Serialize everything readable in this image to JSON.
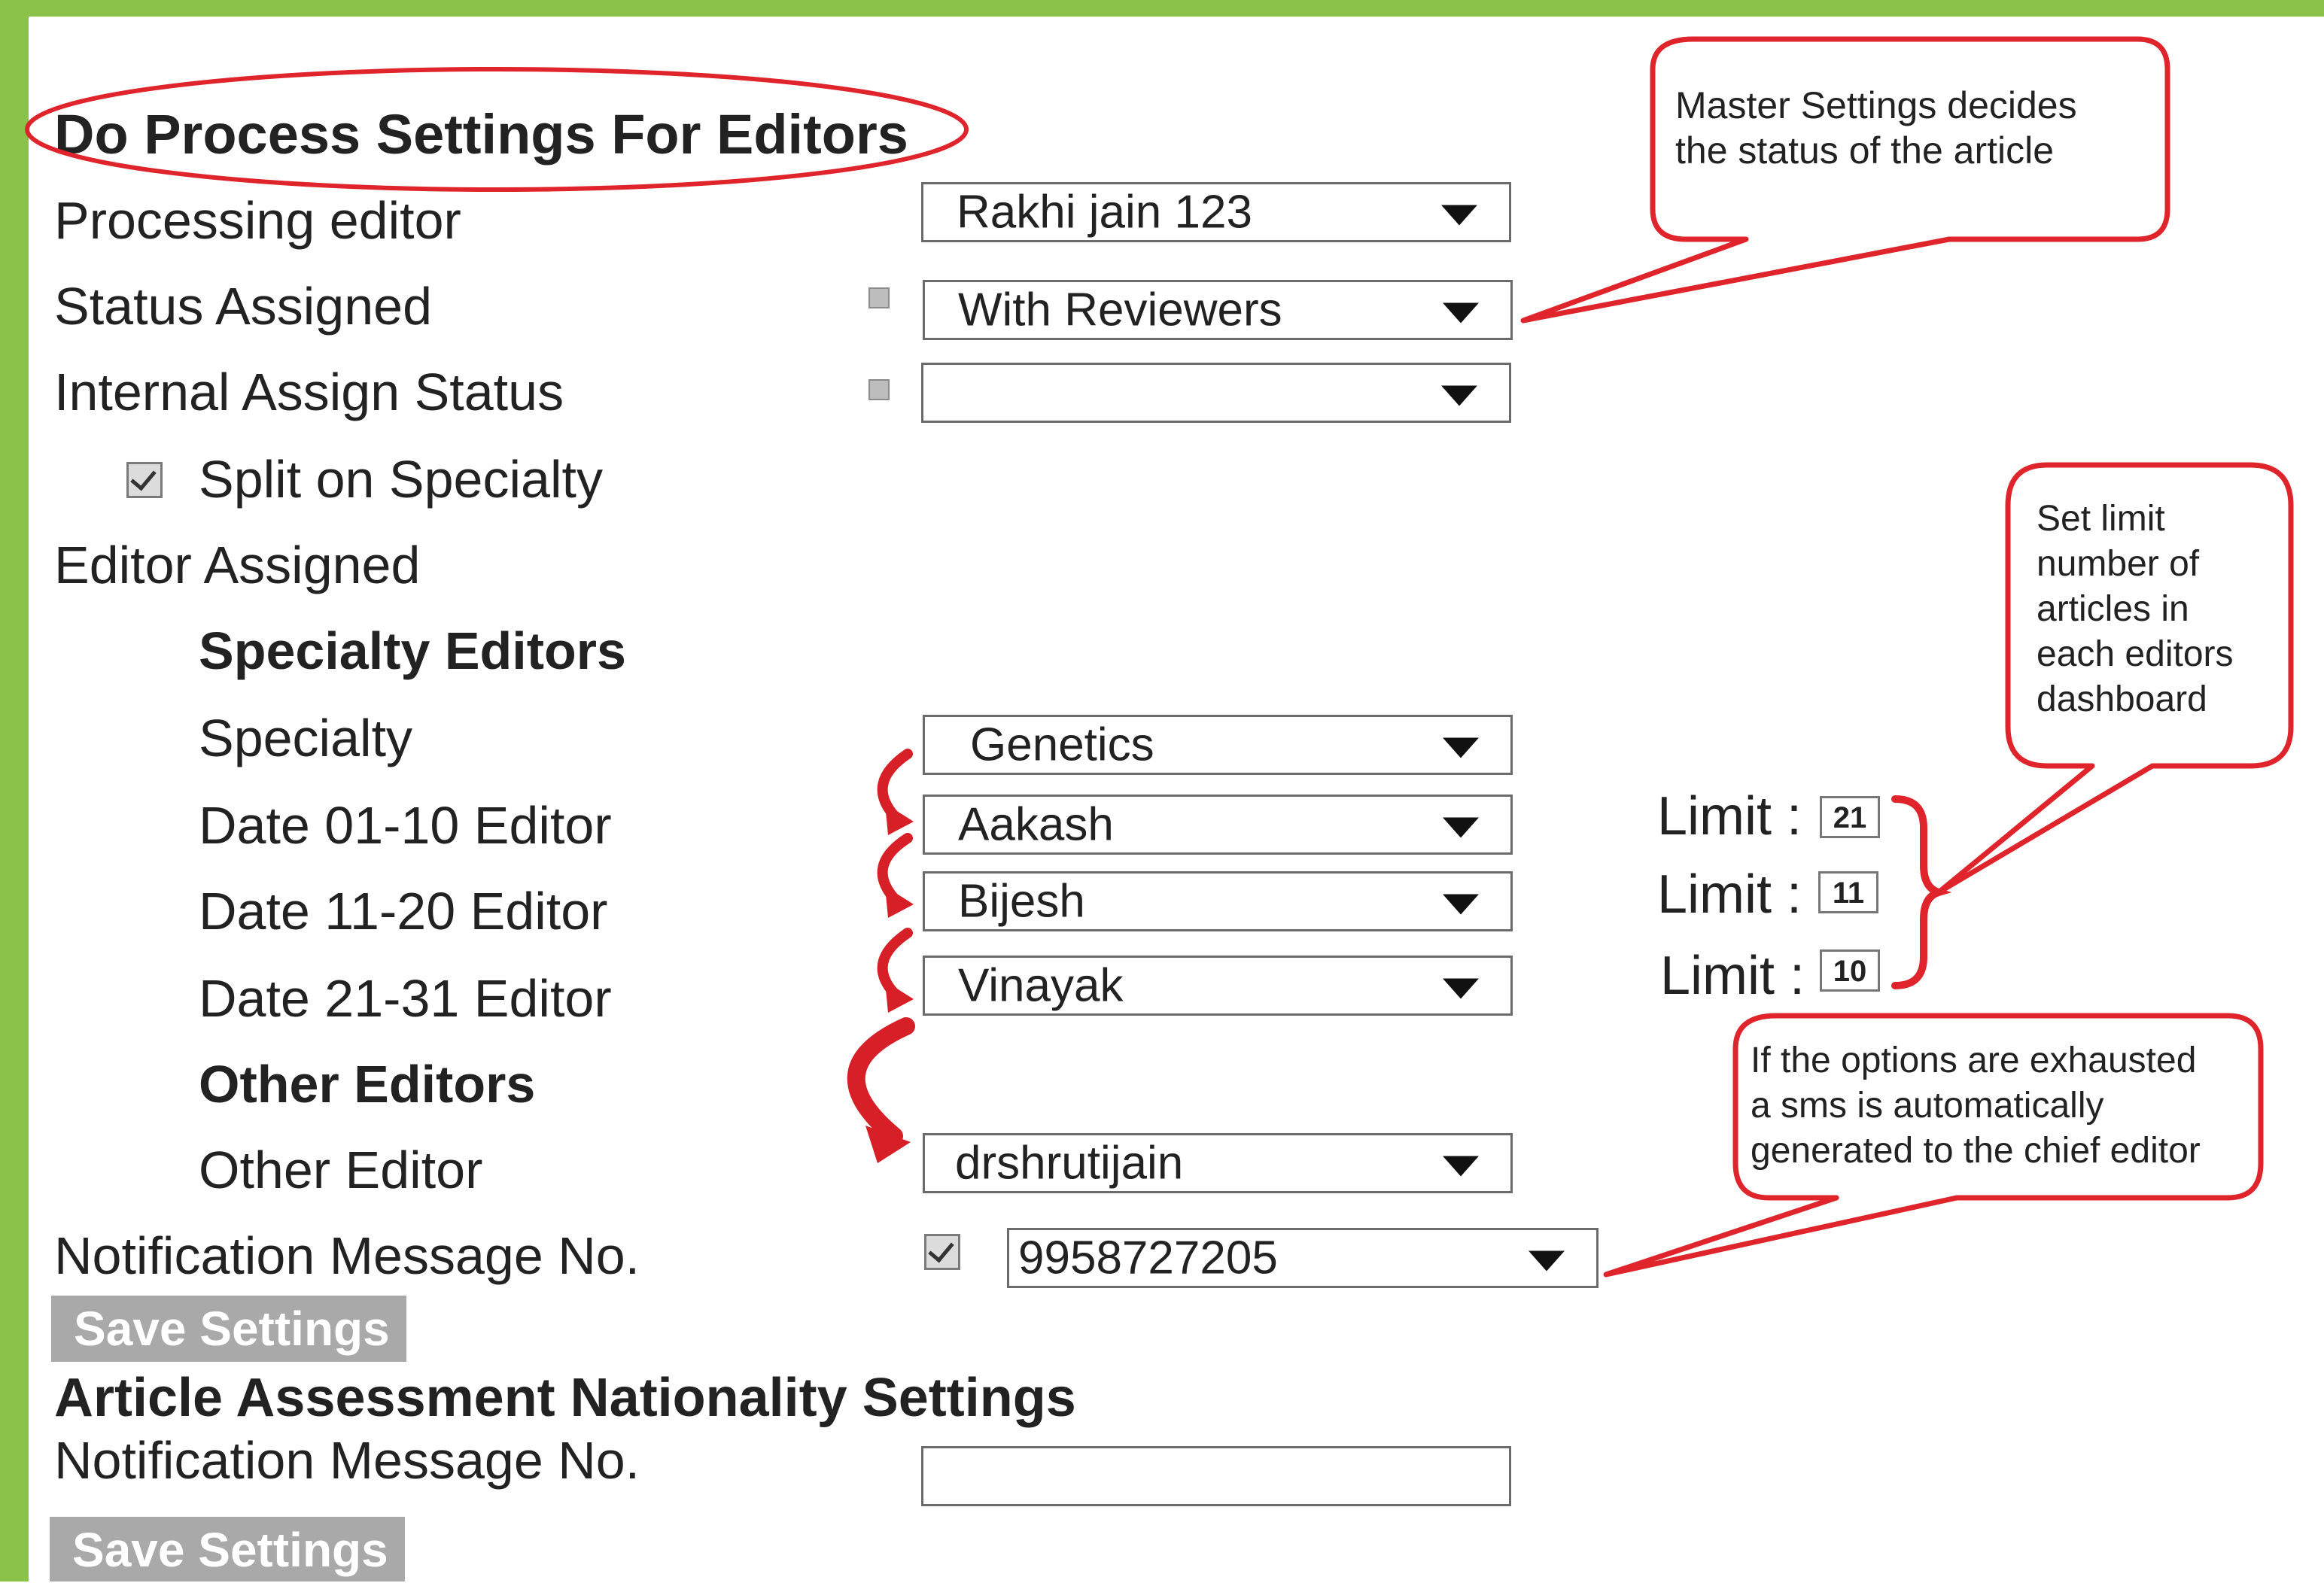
{
  "process_section": {
    "title": "Do Process Settings For Editors",
    "processing_editor": {
      "label": "Processing editor",
      "value": "Rakhi jain 123"
    },
    "status_assigned": {
      "label": "Status Assigned",
      "value": "With Reviewers"
    },
    "internal_assign_status": {
      "label": "Internal Assign Status",
      "value": ""
    },
    "split_on_specialty": {
      "label": "Split on Specialty",
      "checked": true
    },
    "editor_assigned_label": "Editor Assigned",
    "specialty_editors_heading": "Specialty Editors",
    "specialty": {
      "label": "Specialty",
      "value": "Genetics"
    },
    "date_editors": [
      {
        "label": "Date 01-10 Editor",
        "value": "Aakash",
        "limit_label": "Limit :",
        "limit": "21"
      },
      {
        "label": "Date 11-20 Editor",
        "value": "Bijesh",
        "limit_label": "Limit :",
        "limit": "11"
      },
      {
        "label": "Date 21-31 Editor",
        "value": "Vinayak",
        "limit_label": "Limit :",
        "limit": "10"
      }
    ],
    "other_editors_heading": "Other Editors",
    "other_editor": {
      "label": "Other Editor",
      "value": "drshrutijain"
    },
    "notification": {
      "label": "Notification Message No.",
      "value": "9958727205",
      "checked": true
    },
    "save_label": "Save Settings"
  },
  "nationality_section": {
    "title": "Article Assessment Nationality Settings",
    "notification_label": "Notification Message No.",
    "notification_value": "",
    "save_label": "Save Settings"
  },
  "callouts": {
    "master_settings": [
      "Master Settings decides",
      "the status of the article"
    ],
    "set_limit": [
      "Set limit",
      "number of",
      "articles in",
      "each editors",
      "dashboard"
    ],
    "options_exhausted": [
      "If the options are exhausted",
      "a sms is automatically",
      "generated to the chief editor"
    ]
  },
  "colors": {
    "frame_green": "#8bc34a",
    "annotation_red": "#e0242b",
    "button_gray": "#a9a9a9"
  }
}
